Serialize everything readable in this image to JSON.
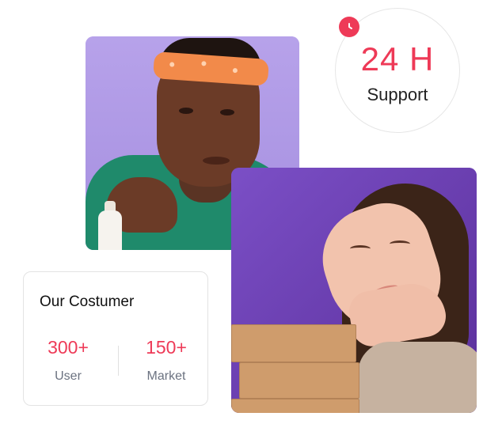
{
  "support": {
    "hours": "24 H",
    "label": "Support"
  },
  "customers": {
    "title": "Our Costumer",
    "stats": [
      {
        "value": "300+",
        "label": "User"
      },
      {
        "value": "150+",
        "label": "Market"
      }
    ]
  },
  "colors": {
    "accent": "#ee3a57",
    "muted_text": "#6b7280",
    "purple_bg": "#b39de6"
  },
  "icons": {
    "badge": "clock-icon"
  }
}
